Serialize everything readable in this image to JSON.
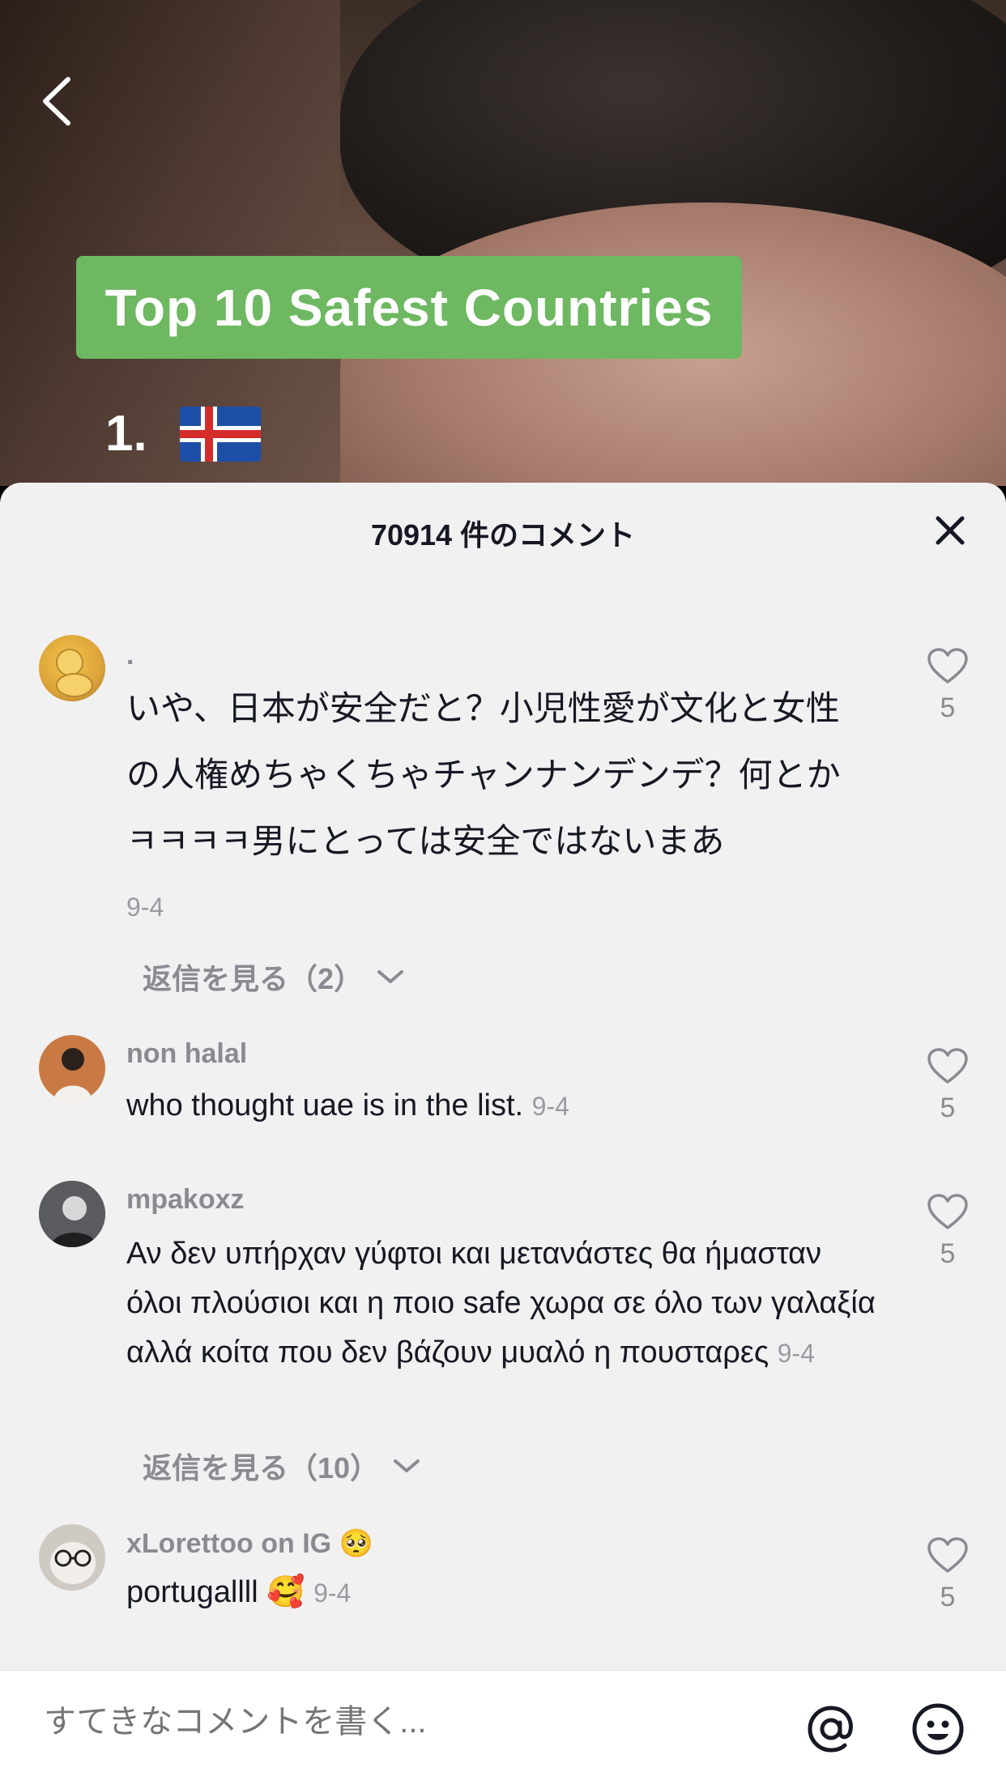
{
  "video": {
    "overlay_title": "Top 10 Safest Countries",
    "rank_label": "1."
  },
  "sheet": {
    "title": "70914 件のコメント"
  },
  "comments": [
    {
      "username": ".",
      "text": "いや、日本が安全だと？小児性愛が文化と女性の人権めちゃくちゃチャンナンデンデ？何とかㅋㅋㅋㅋ男にとっては安全ではないまあ",
      "date": "9-4",
      "likes": "5",
      "replies_label": "返信を見る（2）"
    },
    {
      "username": "non halal",
      "text": "who thought uae is in the list.",
      "date": "9-4",
      "likes": "5"
    },
    {
      "username": "mpakoxz",
      "text": "Αν δεν υπήρχαν γύφτοι και μετανάστες θα ήμασταν όλοι πλούσιοι και η ποιο safe χωρα σε όλο των γαλαξία αλλά κοίτα που δεν βάζουν μυαλό η πουσταρες",
      "date": "9-4",
      "likes": "5",
      "replies_label": "返信を見る（10）"
    },
    {
      "username": "xLorettoo on IG 🥺",
      "text": "portugallll 🥰",
      "date": "9-4",
      "likes": "5"
    }
  ],
  "input": {
    "placeholder": "すてきなコメントを書く..."
  }
}
